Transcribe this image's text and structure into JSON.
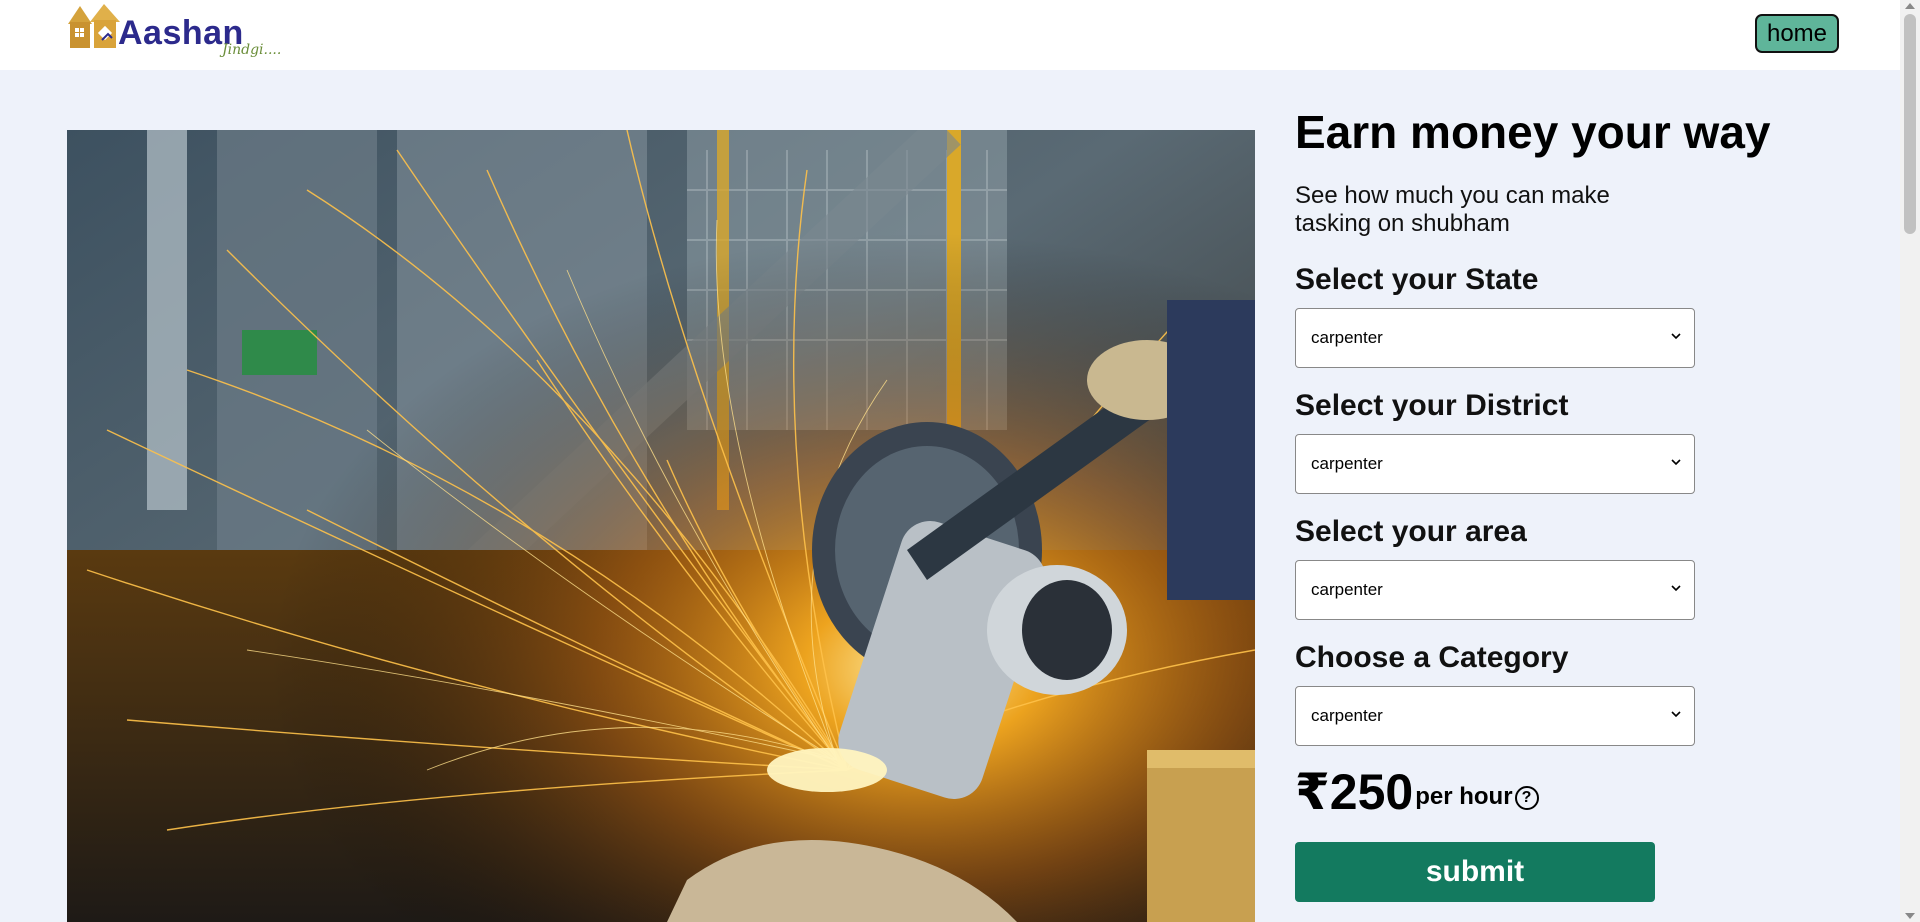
{
  "header": {
    "logo_text": "Aashan",
    "logo_tagline": "Jindgi....",
    "home_label": "home"
  },
  "hero": {
    "image_subject": "angle grinder cutting metal with sparks"
  },
  "panel": {
    "headline": "Earn money your way",
    "subtext": "See how much you can make tasking on shubham",
    "state": {
      "label": "Select your State",
      "value": "carpenter"
    },
    "district": {
      "label": "Select your District",
      "value": "carpenter"
    },
    "area": {
      "label": "Select your area",
      "value": "carpenter"
    },
    "category": {
      "label": "Choose a Category",
      "value": "carpenter"
    },
    "price": "₹250",
    "per_hour": "per hour",
    "help_symbol": "?",
    "submit_label": "submit"
  },
  "icons": {
    "logo": "house-logo-icon",
    "help": "question-circle-icon",
    "chevron": "chevron-down-icon"
  },
  "colors": {
    "page_bg": "#eef2fa",
    "home_button": "#5fb59a",
    "submit_button": "#137a5f",
    "brand_text": "#2c2a8c"
  }
}
